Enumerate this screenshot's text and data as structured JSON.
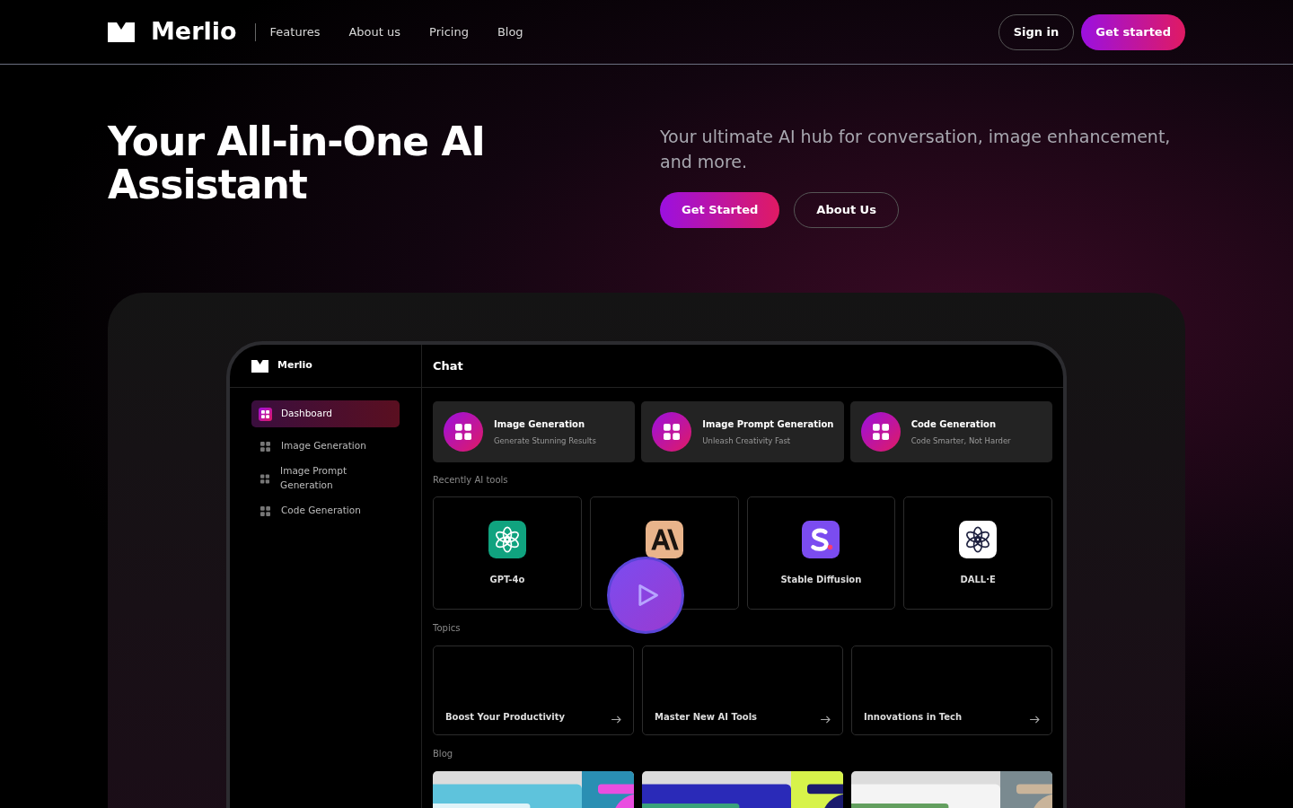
{
  "nav": {
    "brand": "Merlio",
    "links": [
      "Features",
      "About us",
      "Pricing",
      "Blog"
    ],
    "sign_in": "Sign in",
    "get_started": "Get started"
  },
  "hero": {
    "title": "Your All-in-One AI Assistant",
    "subtitle": "Your ultimate AI hub for conversation, image enhancement, and more.",
    "primary": "Get Started",
    "secondary": "About Us"
  },
  "app": {
    "brand": "Merlio",
    "header": "Chat",
    "sidebar": [
      {
        "label": "Dashboard",
        "selected": true
      },
      {
        "label": "Image Generation",
        "selected": false
      },
      {
        "label": "Image Prompt Generation",
        "selected": false
      },
      {
        "label": "Code Generation",
        "selected": false
      }
    ],
    "features": [
      {
        "title": "Image Generation",
        "subtitle": "Generate Stunning Results"
      },
      {
        "title": "Image Prompt Generation",
        "subtitle": "Unleash Creativity Fast"
      },
      {
        "title": "Code Generation",
        "subtitle": "Code Smarter, Not Harder"
      }
    ],
    "recent_label": "Recently AI tools",
    "tools": [
      {
        "kind": "gpt",
        "name": "GPT-4o"
      },
      {
        "kind": "anthropic"
      },
      {
        "kind": "stable",
        "name": "Stable Diffusion"
      },
      {
        "kind": "dalle",
        "name": "DALL·E"
      }
    ],
    "topics_label": "Topics",
    "topics": [
      "Boost Your Productivity",
      "Master New AI Tools",
      "Innovations in Tech"
    ],
    "blog_label": "Blog",
    "blog": [
      {
        "kind": "picture"
      },
      {
        "kind": "picture"
      },
      {
        "kind": "picture"
      }
    ]
  }
}
